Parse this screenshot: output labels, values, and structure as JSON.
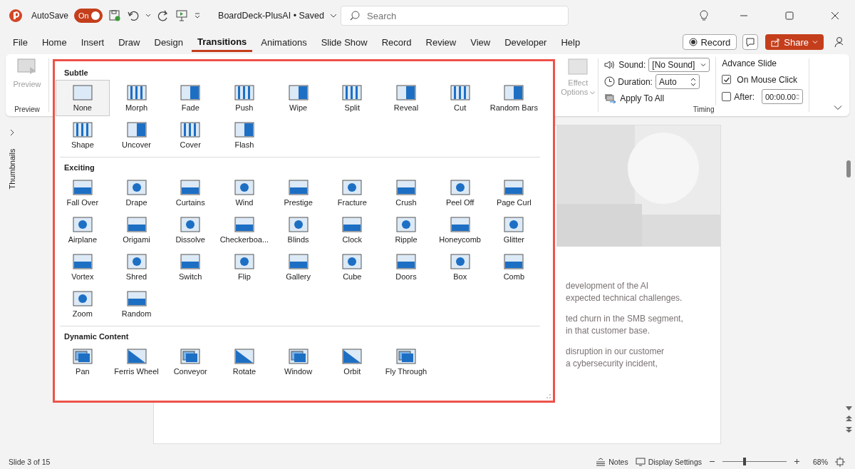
{
  "title_bar": {
    "autosave_label": "AutoSave",
    "autosave_toggle": {
      "label": "On",
      "on": true
    },
    "document_title": "BoardDeck-PlusAI • Saved",
    "search": {
      "placeholder": "Search"
    }
  },
  "menu_tabs": [
    {
      "label": "File",
      "selected": false
    },
    {
      "label": "Home",
      "selected": false
    },
    {
      "label": "Insert",
      "selected": false
    },
    {
      "label": "Draw",
      "selected": false
    },
    {
      "label": "Design",
      "selected": false
    },
    {
      "label": "Transitions",
      "selected": true
    },
    {
      "label": "Animations",
      "selected": false
    },
    {
      "label": "Slide Show",
      "selected": false
    },
    {
      "label": "Record",
      "selected": false
    },
    {
      "label": "Review",
      "selected": false
    },
    {
      "label": "View",
      "selected": false
    },
    {
      "label": "Developer",
      "selected": false
    },
    {
      "label": "Help",
      "selected": false
    }
  ],
  "record_button": "Record",
  "share_button": "Share",
  "ribbon": {
    "preview_button": {
      "label": "Preview",
      "disabled": true
    },
    "preview_group": "Preview",
    "effect_options": {
      "label": "Effect Options",
      "disabled": true
    },
    "sound": {
      "label": "Sound:",
      "value": "[No Sound]"
    },
    "duration": {
      "label": "Duration:",
      "value": "Auto"
    },
    "apply_to_all": "Apply To All",
    "advance_slide": "Advance Slide",
    "on_mouse_click": {
      "label": "On Mouse Click",
      "checked": true
    },
    "after": {
      "label": "After:",
      "checked": false,
      "value": "00:00.00"
    },
    "timing_group": "Timing"
  },
  "thumbnails_pane": {
    "label": "Thumbnails"
  },
  "gallery": {
    "sections": [
      {
        "title": "Subtle",
        "items": [
          {
            "label": "None",
            "selected": true
          },
          {
            "label": "Morph",
            "selected": false
          },
          {
            "label": "Fade",
            "selected": false
          },
          {
            "label": "Push",
            "selected": false
          },
          {
            "label": "Wipe",
            "selected": false
          },
          {
            "label": "Split",
            "selected": false
          },
          {
            "label": "Reveal",
            "selected": false
          },
          {
            "label": "Cut",
            "selected": false
          },
          {
            "label": "Random Bars",
            "selected": false
          },
          {
            "label": "Shape",
            "selected": false
          },
          {
            "label": "Uncover",
            "selected": false
          },
          {
            "label": "Cover",
            "selected": false
          },
          {
            "label": "Flash",
            "selected": false
          }
        ]
      },
      {
        "title": "Exciting",
        "items": [
          {
            "label": "Fall Over",
            "selected": false
          },
          {
            "label": "Drape",
            "selected": false
          },
          {
            "label": "Curtains",
            "selected": false
          },
          {
            "label": "Wind",
            "selected": false
          },
          {
            "label": "Prestige",
            "selected": false
          },
          {
            "label": "Fracture",
            "selected": false
          },
          {
            "label": "Crush",
            "selected": false
          },
          {
            "label": "Peel Off",
            "selected": false
          },
          {
            "label": "Page Curl",
            "selected": false
          },
          {
            "label": "Airplane",
            "selected": false
          },
          {
            "label": "Origami",
            "selected": false
          },
          {
            "label": "Dissolve",
            "selected": false
          },
          {
            "label": "Checkerboa...",
            "selected": false
          },
          {
            "label": "Blinds",
            "selected": false
          },
          {
            "label": "Clock",
            "selected": false
          },
          {
            "label": "Ripple",
            "selected": false
          },
          {
            "label": "Honeycomb",
            "selected": false
          },
          {
            "label": "Glitter",
            "selected": false
          },
          {
            "label": "Vortex",
            "selected": false
          },
          {
            "label": "Shred",
            "selected": false
          },
          {
            "label": "Switch",
            "selected": false
          },
          {
            "label": "Flip",
            "selected": false
          },
          {
            "label": "Gallery",
            "selected": false
          },
          {
            "label": "Cube",
            "selected": false
          },
          {
            "label": "Doors",
            "selected": false
          },
          {
            "label": "Box",
            "selected": false
          },
          {
            "label": "Comb",
            "selected": false
          },
          {
            "label": "Zoom",
            "selected": false
          },
          {
            "label": "Random",
            "selected": false
          }
        ]
      },
      {
        "title": "Dynamic Content",
        "items": [
          {
            "label": "Pan",
            "selected": false
          },
          {
            "label": "Ferris Wheel",
            "selected": false
          },
          {
            "label": "Conveyor",
            "selected": false
          },
          {
            "label": "Rotate",
            "selected": false
          },
          {
            "label": "Window",
            "selected": false
          },
          {
            "label": "Orbit",
            "selected": false
          },
          {
            "label": "Fly Through",
            "selected": false
          }
        ]
      }
    ]
  },
  "slide": {
    "paragraphs": [
      [
        "development of the AI",
        "expected technical challenges."
      ],
      [
        "ted churn in the SMB segment,",
        "in that customer base."
      ],
      [
        "disruption in our customer",
        "a cybersecurity incident,"
      ]
    ]
  },
  "status_bar": {
    "slide_counter": "Slide 3 of 15",
    "notes": "Notes",
    "display_settings": "Display Settings",
    "zoom": {
      "level": 0.32,
      "reading": "68%"
    }
  }
}
